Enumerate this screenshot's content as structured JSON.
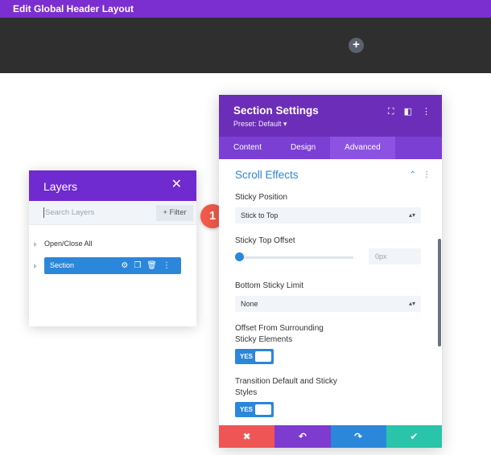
{
  "topbar": {
    "title": "Edit Global Header Layout"
  },
  "header_area": {
    "add_icon": "plus-icon",
    "add_glyph": "+"
  },
  "layers": {
    "title": "Layers",
    "close_glyph": "✕",
    "search_placeholder": "Search Layers",
    "filter_label": "+ Filter",
    "open_close_label": "Open/Close All",
    "section_label": "Section",
    "section_icons": [
      "gear-icon",
      "duplicate-icon",
      "trash-icon",
      "more-icon"
    ]
  },
  "callout": {
    "number": "1"
  },
  "settings": {
    "title": "Section Settings",
    "preset": "Preset: Default ▾",
    "header_icons": [
      "expand-icon",
      "sidebar-icon",
      "more-icon"
    ],
    "tabs": [
      {
        "label": "Content",
        "active": false
      },
      {
        "label": "Design",
        "active": false
      },
      {
        "label": "Advanced",
        "active": true
      }
    ],
    "group_title": "Scroll Effects",
    "sticky_position": {
      "label": "Sticky Position",
      "value": "Stick to Top"
    },
    "sticky_top_offset": {
      "label": "Sticky Top Offset",
      "value": "0px"
    },
    "bottom_sticky_limit": {
      "label": "Bottom Sticky Limit",
      "value": "None"
    },
    "offset_surrounding": {
      "label_line1": "Offset From Surrounding",
      "label_line2": "Sticky Elements",
      "toggle": "YES"
    },
    "transition_default": {
      "label_line1": "Transition Default and Sticky",
      "label_line2": "Styles",
      "toggle": "YES"
    },
    "footer": {
      "cancel_glyph": "✖",
      "undo_glyph": "↶",
      "redo_glyph": "↷",
      "save_glyph": "✔",
      "colors": {
        "cancel": "#ef5555",
        "undo": "#7e3bd0",
        "redo": "#2b87da",
        "save": "#29c4a9"
      }
    }
  },
  "colors": {
    "purple": "#7b2fd0",
    "blue": "#2b87da",
    "callout": "#f15a4a"
  }
}
